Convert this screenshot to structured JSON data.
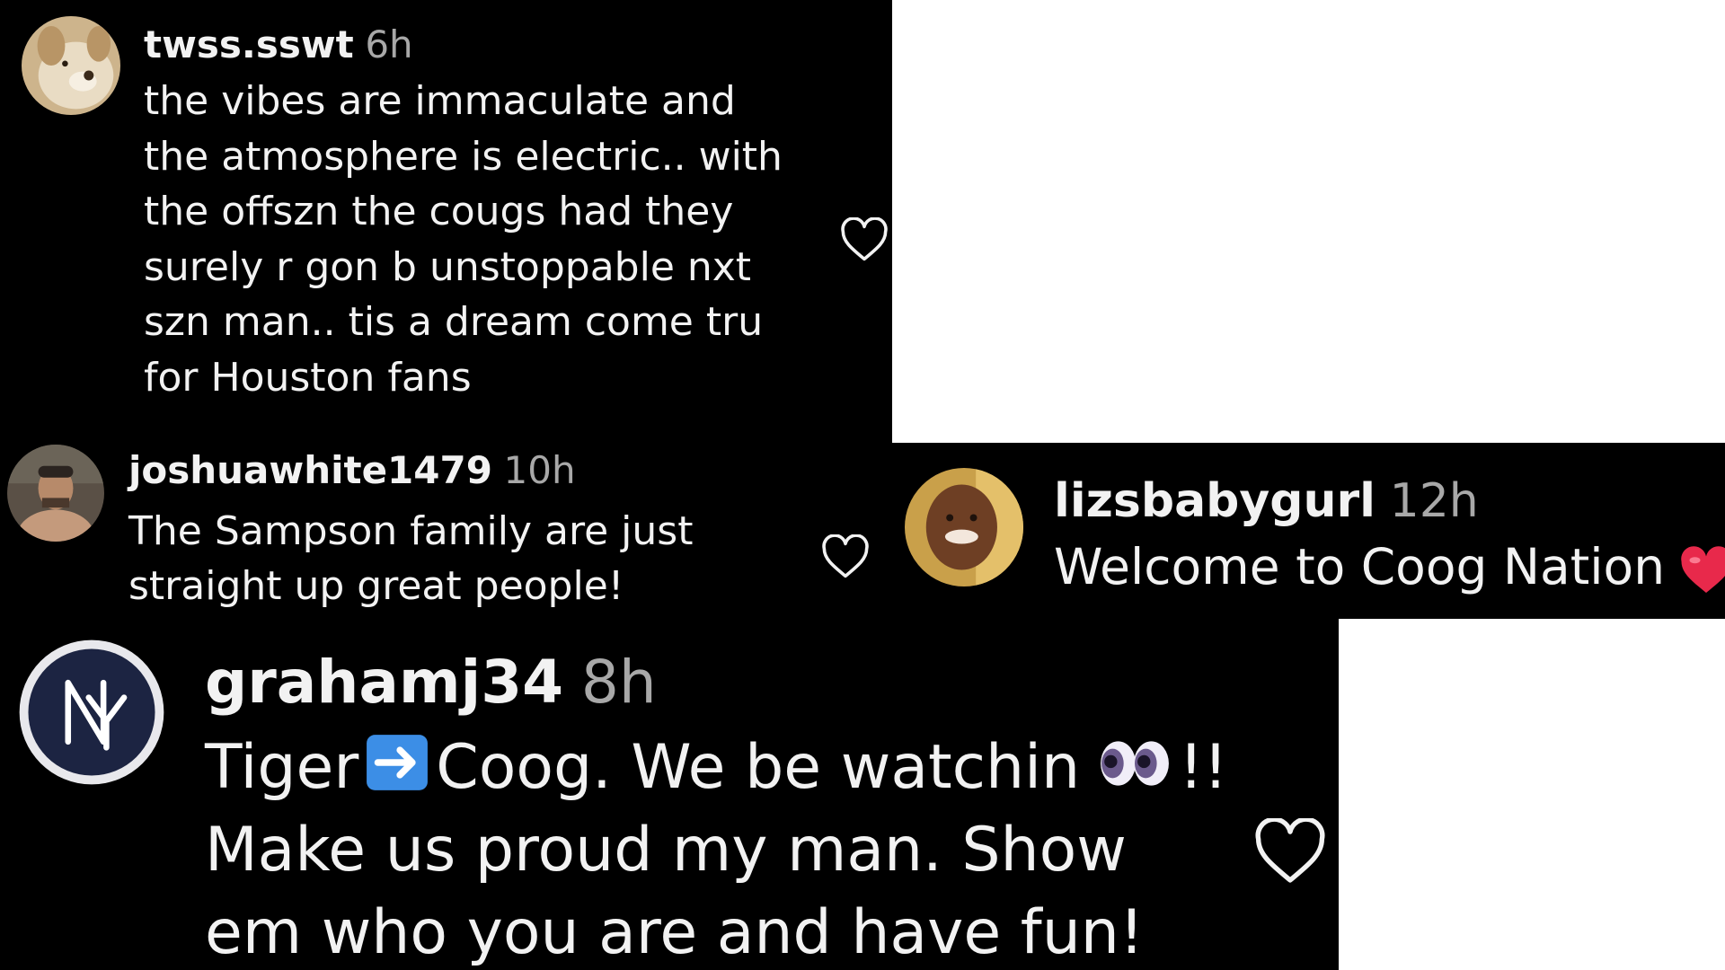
{
  "comments": [
    {
      "username": "twss.sswt",
      "time": "6h",
      "avatar_icon": "dog-photo-avatar",
      "text": "the vibes are immaculate and the atmosphere is electric.. with the offszn the cougs had they surely r gon b unstoppable nxt szn man.. tis a dream come tru for Houston fans",
      "like_icon": "heart-outline-icon"
    },
    {
      "username": "joshuawhite1479",
      "time": "10h",
      "avatar_icon": "man-photo-avatar",
      "text": "The Sampson family are just straight up great people!",
      "like_icon": "heart-outline-icon"
    },
    {
      "username": "lizsbabygurl",
      "time": "12h",
      "avatar_icon": "woman-photo-avatar",
      "text": "Welcome to Coog Nation",
      "emoji": "red-heart-emoji"
    },
    {
      "username": "grahamj34",
      "time": "8h",
      "avatar_icon": "yankees-logo-avatar",
      "text_part1": "Tiger",
      "emoji_arrow": "right-arrow-emoji",
      "text_part2": "Coog. We be watchin",
      "emoji_eyes": "eyes-emoji",
      "text_part3": "!! Make us proud my man. Show em who you are and have fun!",
      "like_icon": "heart-outline-icon"
    }
  ],
  "colors": {
    "background": "#000000",
    "username": "#f2f2f2",
    "timestamp": "#a8a8a8",
    "text": "#f2f2f2",
    "heart_emoji": "#e8294b"
  }
}
